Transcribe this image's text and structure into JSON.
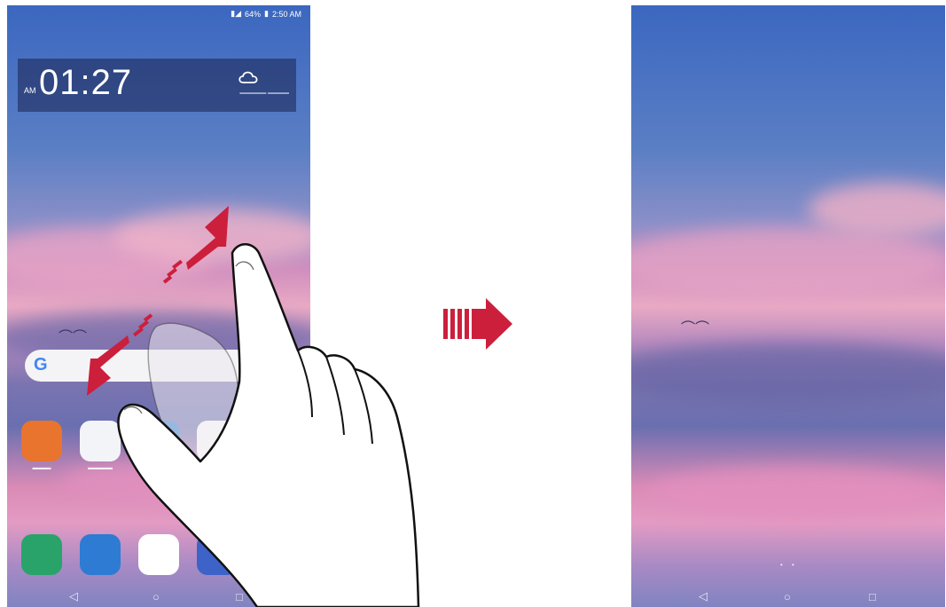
{
  "left_screen": {
    "status_bar": {
      "battery": "64%",
      "time": "2:50 AM"
    },
    "clock_widget": {
      "ampm": "AM",
      "time": "01:27",
      "icon": "cloud-icon"
    },
    "search_bar": {
      "logo": "G"
    },
    "nav": {
      "back": "◁",
      "home": "○",
      "recents": "□"
    }
  },
  "right_screen": {
    "nav": {
      "back": "◁",
      "home": "○",
      "recents": "□"
    }
  },
  "icons": {
    "app_row": [
      "globe-app-icon",
      "fingerprint-app-icon",
      "blue-app-icon",
      "play-store-icon"
    ],
    "dock": [
      "phone-icon",
      "messages-icon",
      "chrome-icon",
      "camera-icon"
    ],
    "transition_arrow": "right-arrow-icon"
  },
  "colors": {
    "arrow_red": "#cc1f3c",
    "sky_blue": "#3b67c0",
    "cloud_pink": "#e9a9c4"
  }
}
